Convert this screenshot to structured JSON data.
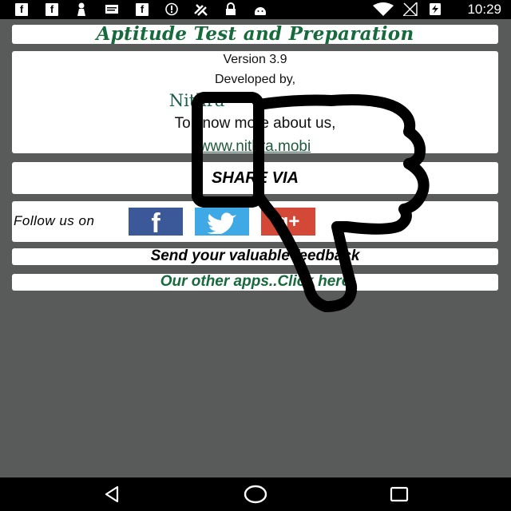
{
  "status_bar": {
    "time": "10:29",
    "left_icons": [
      "facebook-notification-icon",
      "facebook-notification-icon",
      "person-notification-icon",
      "message-notification-icon",
      "facebook-notification-icon",
      "sync-icon",
      "satellite-icon",
      "lock-icon",
      "android-icon"
    ],
    "right_icons": [
      "wifi-icon",
      "signal-icon",
      "battery-charging-icon"
    ]
  },
  "header": {
    "title": "Aptitude Test and Preparation"
  },
  "about": {
    "version": "Version 3.9",
    "developed_by": "Developed by,",
    "brand": "Nithra",
    "know_more": "To know more about us,",
    "url": "www.nithra.mobi"
  },
  "share": {
    "label": "SHARE VIA"
  },
  "follow": {
    "label": "Follow us on",
    "networks": [
      {
        "name": "facebook",
        "glyph": "f",
        "color": "#3b5998"
      },
      {
        "name": "twitter",
        "glyph": "🐦",
        "color": "#3fa9e6"
      },
      {
        "name": "google-plus",
        "glyph": "g+",
        "color": "#d34836"
      }
    ]
  },
  "feedback": {
    "label": "Send your valuable feedback"
  },
  "other_apps": {
    "label": "Our other apps..Click here"
  },
  "overlay": {
    "icon": "thumbs-down-icon"
  },
  "nav_bar": {
    "buttons": [
      "back-icon",
      "home-icon",
      "recents-icon"
    ]
  },
  "colors": {
    "background": "#595b5b",
    "accent_green": "#176a3c",
    "facebook": "#3b5998",
    "twitter": "#3fa9e6",
    "google_plus": "#d34836"
  }
}
